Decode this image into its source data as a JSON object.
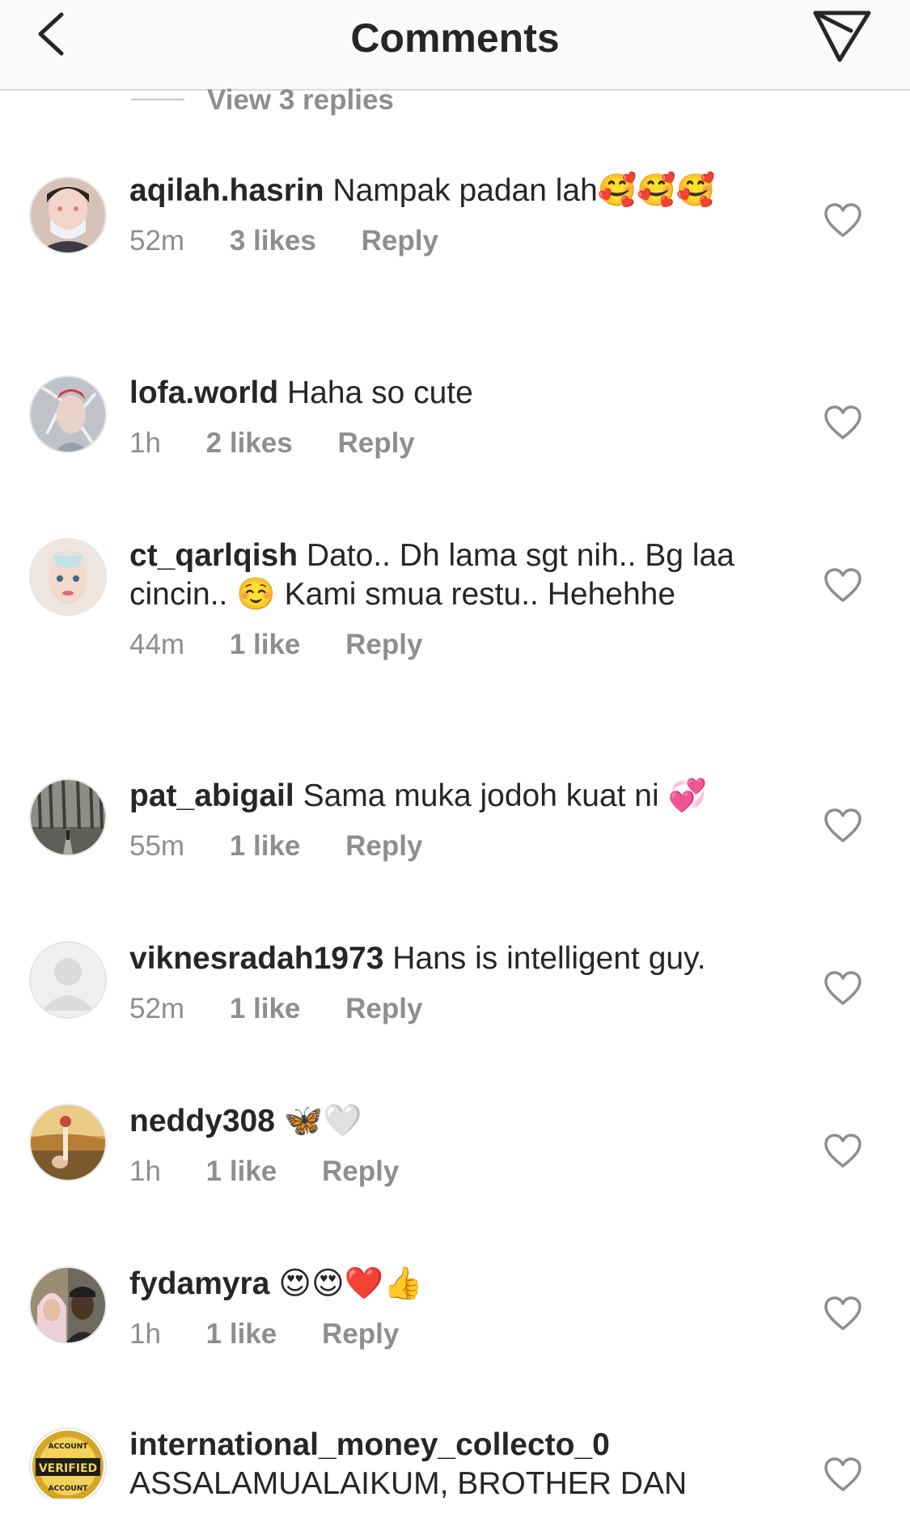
{
  "header": {
    "title": "Comments",
    "back_icon": "chevron-left-icon",
    "send_icon": "paper-plane-icon"
  },
  "replies_toggle": {
    "label": "View 3 replies"
  },
  "comments": [
    {
      "username": "aqilah.hasrin",
      "text": "Nampak padan lah🥰🥰🥰",
      "time": "52m",
      "likes": "3 likes",
      "reply": "Reply"
    },
    {
      "username": "lofa.world",
      "text": "Haha so cute",
      "time": "1h",
      "likes": "2 likes",
      "reply": "Reply"
    },
    {
      "username": "ct_qarlqish",
      "text": "Dato.. Dh lama sgt nih.. Bg laa cincin.. ☺️ Kami smua restu.. Hehehhe",
      "time": "44m",
      "likes": "1 like",
      "reply": "Reply"
    },
    {
      "username": "pat_abigail",
      "text": "Sama muka jodoh kuat ni 💞",
      "time": "55m",
      "likes": "1 like",
      "reply": "Reply"
    },
    {
      "username": "viknesradah1973",
      "text": "Hans is intelligent guy.",
      "time": "52m",
      "likes": "1 like",
      "reply": "Reply"
    },
    {
      "username": "neddy308",
      "text": "🦋🤍",
      "time": "1h",
      "likes": "1 like",
      "reply": "Reply"
    },
    {
      "username": "fydamyra",
      "text": "😍😍❤️👍",
      "time": "1h",
      "likes": "1 like",
      "reply": "Reply"
    },
    {
      "username": "international_money_collecto_0",
      "text": "ASSALAMUALAIKUM, BROTHER DAN",
      "time": "",
      "likes": "",
      "reply": ""
    }
  ],
  "avatar_badge": {
    "top": "ACCOUNT",
    "middle": "VERIFIED",
    "bottom": "ACCOUNT"
  },
  "colors": {
    "text": "#262626",
    "secondary": "#8e8e8e",
    "divider": "#dbdbdb",
    "header_bg": "#fafafa"
  }
}
